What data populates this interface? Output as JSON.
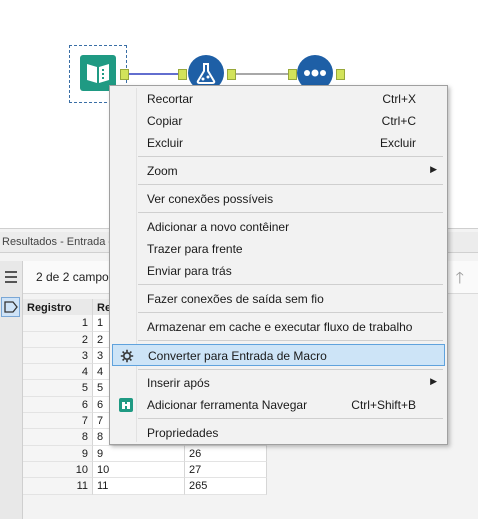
{
  "results": {
    "title": "Resultados - Entrada d",
    "fields_count": "2 de 2 campos",
    "columns": [
      "Registro",
      "Re",
      ""
    ],
    "rows": [
      [
        "1",
        "1",
        ""
      ],
      [
        "2",
        "2",
        ""
      ],
      [
        "3",
        "3",
        ""
      ],
      [
        "4",
        "4",
        ""
      ],
      [
        "5",
        "5",
        ""
      ],
      [
        "6",
        "6",
        ""
      ],
      [
        "7",
        "7",
        ""
      ],
      [
        "8",
        "8",
        "45"
      ],
      [
        "9",
        "9",
        "26"
      ],
      [
        "10",
        "10",
        "27"
      ],
      [
        "11",
        "11",
        "265"
      ]
    ]
  },
  "context_menu": {
    "cut": {
      "label": "Recortar",
      "shortcut": "Ctrl+X"
    },
    "copy": {
      "label": "Copiar",
      "shortcut": "Ctrl+C"
    },
    "delete": {
      "label": "Excluir",
      "shortcut": "Excluir"
    },
    "zoom": {
      "label": "Zoom"
    },
    "view_connections": {
      "label": "Ver conexões possíveis"
    },
    "add_container": {
      "label": "Adicionar a novo contêiner"
    },
    "bring_front": {
      "label": "Trazer para frente"
    },
    "send_back": {
      "label": "Enviar para trás"
    },
    "wireless": {
      "label": "Fazer conexões de saída sem fio"
    },
    "cache_run": {
      "label": "Armazenar em cache e executar fluxo de trabalho"
    },
    "convert_macro": {
      "label": "Converter para Entrada de Macro"
    },
    "insert_after": {
      "label": "Inserir após"
    },
    "add_browse": {
      "label": "Adicionar ferramenta Navegar",
      "shortcut": "Ctrl+Shift+B"
    },
    "properties": {
      "label": "Propriedades"
    }
  },
  "colors": {
    "input_tool": "#1f9a83",
    "tool_blue": "#1e5fa6",
    "highlight": "#cde4f7"
  }
}
